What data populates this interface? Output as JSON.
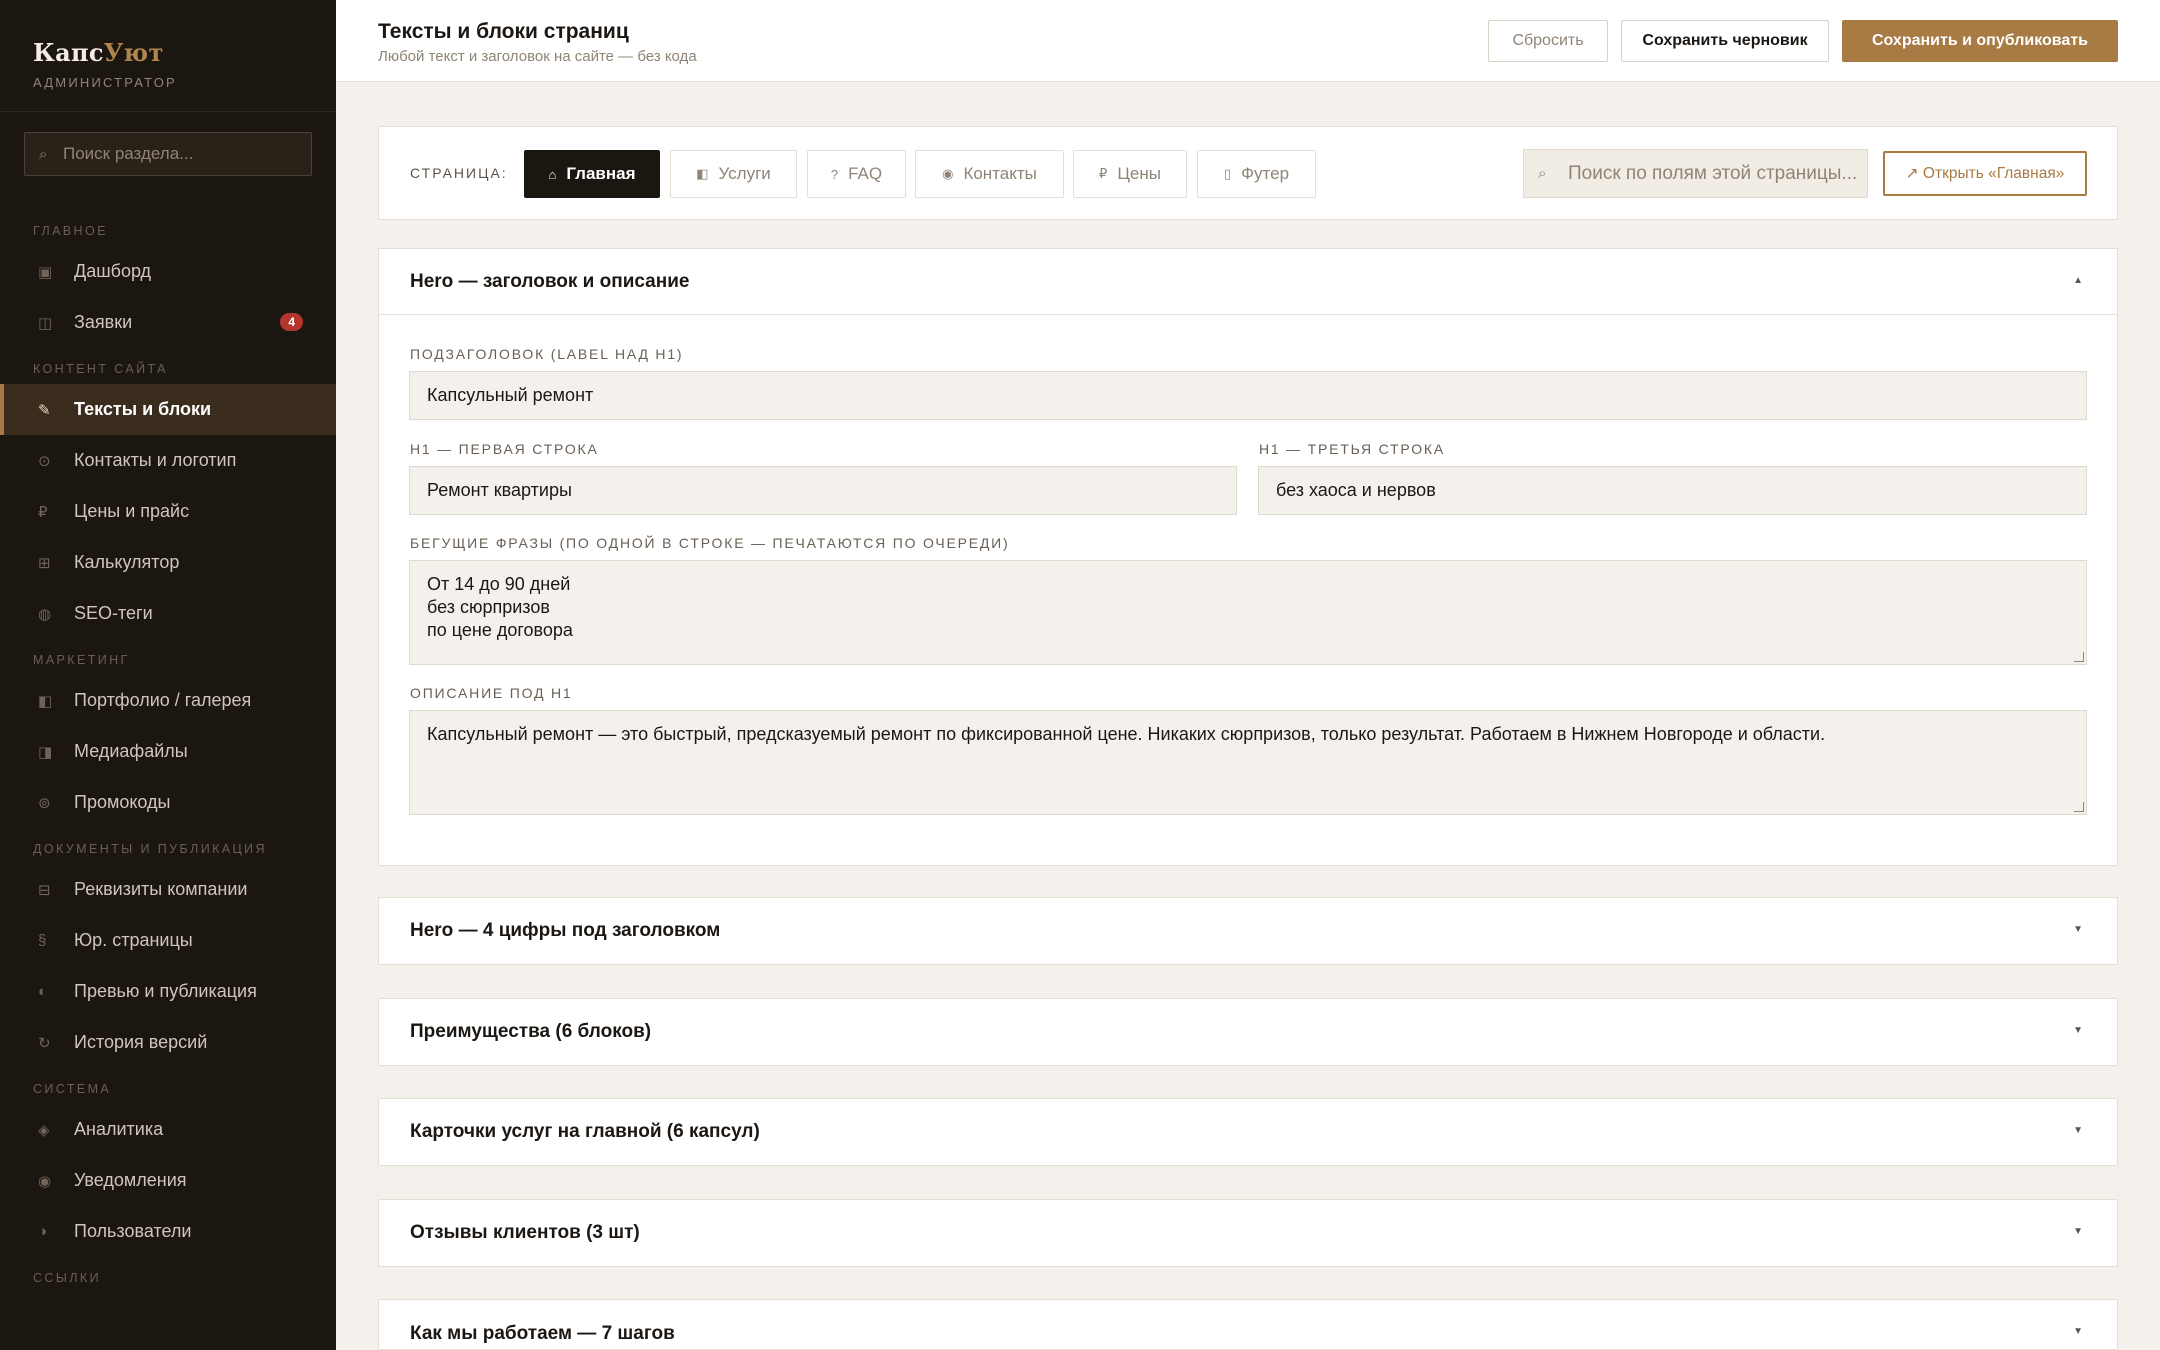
{
  "brand": {
    "name_main": "Капс",
    "name_accent": "Уют",
    "role": "АДМИНИСТРАТОР"
  },
  "sidebar": {
    "search_placeholder": "Поиск раздела...",
    "groups": [
      {
        "label": "ГЛАВНОЕ",
        "items": [
          {
            "label": "Дашборд",
            "icon": "dashboard-icon"
          },
          {
            "label": "Заявки",
            "icon": "requests-icon",
            "badge": "4"
          }
        ]
      },
      {
        "label": "КОНТЕНТ САЙТА",
        "items": [
          {
            "label": "Тексты и блоки",
            "icon": "pencil-icon",
            "active": true
          },
          {
            "label": "Контакты и логотип",
            "icon": "contacts-icon"
          },
          {
            "label": "Цены и прайс",
            "icon": "ruble-icon"
          },
          {
            "label": "Калькулятор",
            "icon": "calculator-icon"
          },
          {
            "label": "SEO-теги",
            "icon": "seo-icon"
          }
        ]
      },
      {
        "label": "МАРКЕТИНГ",
        "items": [
          {
            "label": "Портфолио / галерея",
            "icon": "gallery-icon"
          },
          {
            "label": "Медиафайлы",
            "icon": "media-icon"
          },
          {
            "label": "Промокоды",
            "icon": "promo-icon"
          }
        ]
      },
      {
        "label": "ДОКУМЕНТЫ И ПУБЛИКАЦИЯ",
        "items": [
          {
            "label": "Реквизиты компании",
            "icon": "requisites-icon"
          },
          {
            "label": "Юр. страницы",
            "icon": "section-sign-icon"
          },
          {
            "label": "Превью и публикация",
            "icon": "preview-icon"
          },
          {
            "label": "История версий",
            "icon": "history-icon"
          }
        ]
      },
      {
        "label": "СИСТЕМА",
        "items": [
          {
            "label": "Аналитика",
            "icon": "analytics-icon"
          },
          {
            "label": "Уведомления",
            "icon": "bell-icon"
          },
          {
            "label": "Пользователи",
            "icon": "users-icon"
          }
        ]
      },
      {
        "label": "ССЫЛКИ",
        "items": []
      }
    ]
  },
  "header": {
    "title": "Тексты и блоки страниц",
    "subtitle": "Любой текст и заголовок на сайте — без кода",
    "reset_label": "Сбросить",
    "draft_label": "Сохранить черновик",
    "publish_label": "Сохранить и опубликовать"
  },
  "pages": {
    "label": "СТРАНИЦА:",
    "tabs": [
      {
        "label": "Главная",
        "icon": "⌂",
        "active": true
      },
      {
        "label": "Услуги",
        "icon": "◧"
      },
      {
        "label": "FAQ",
        "icon": "?"
      },
      {
        "label": "Контакты",
        "icon": "◉"
      },
      {
        "label": "Цены",
        "icon": "₽"
      },
      {
        "label": "Футер",
        "icon": "▯"
      }
    ],
    "search_placeholder": "Поиск по полям этой страницы...",
    "open_label": "↗ Открыть «Главная»"
  },
  "hero": {
    "title": "Hero — заголовок и описание",
    "subheading_label": "ПОДЗАГОЛОВОК (LABEL НАД H1)",
    "subheading_value": "Капсульный ремонт",
    "h1_first_label": "H1 — ПЕРВАЯ СТРОКА",
    "h1_first_value": "Ремонт квартиры",
    "h1_third_label": "H1 — ТРЕТЬЯ СТРОКА",
    "h1_third_value": "без хаоса и нервов",
    "phrases_label": "БЕГУЩИЕ ФРАЗЫ (ПО ОДНОЙ В СТРОКЕ — ПЕЧАТАЮТСЯ ПО ОЧЕРЕДИ)",
    "phrases_value": "От 14 до 90 дней\nбез сюрпризов\nпо цене договора",
    "description_label": "ОПИСАНИЕ ПОД H1",
    "description_value": "Капсульный ремонт — это быстрый, предсказуемый ремонт по фиксированной цене. Никаких сюрпризов, только результат. Работаем в Нижнем Новгороде и области."
  },
  "sections": [
    {
      "title": "Hero — 4 цифры под заголовком"
    },
    {
      "title": "Преимущества (6 блоков)"
    },
    {
      "title": "Карточки услуг на главной (6 капсул)"
    },
    {
      "title": "Отзывы клиентов (3 шт)"
    },
    {
      "title": "Как мы работаем — 7 шагов"
    }
  ],
  "colors": {
    "accent": "#a87a44",
    "sidebar_bg": "#1c1610",
    "badge": "#b3352c",
    "page_bg": "#f4f1ec"
  }
}
